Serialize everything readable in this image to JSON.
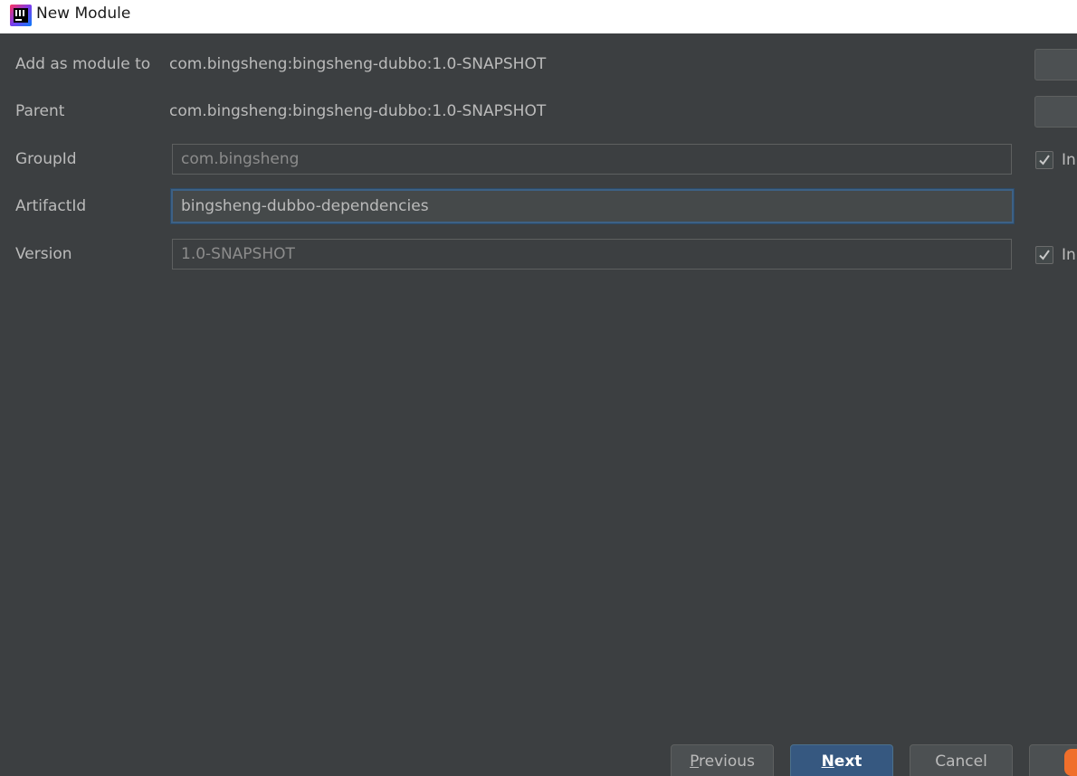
{
  "window": {
    "title": "New Module",
    "app_icon": "intellij-idea-icon"
  },
  "form": {
    "add_as_module_to": {
      "label": "Add as module to",
      "value": "com.bingsheng:bingsheng-dubbo:1.0-SNAPSHOT"
    },
    "parent": {
      "label": "Parent",
      "value": "com.bingsheng:bingsheng-dubbo:1.0-SNAPSHOT"
    },
    "group_id": {
      "label": "GroupId",
      "value": "com.bingsheng",
      "inherit_checked": true,
      "inherit_label": "In"
    },
    "artifact_id": {
      "label": "ArtifactId",
      "value": "bingsheng-dubbo-dependencies"
    },
    "version": {
      "label": "Version",
      "value": "1.0-SNAPSHOT",
      "inherit_checked": true,
      "inherit_label": "In"
    }
  },
  "footer": {
    "previous": {
      "mnemonic": "P",
      "rest": "revious"
    },
    "next": {
      "mnemonic": "N",
      "rest": "ext"
    },
    "cancel": "Cancel"
  },
  "colors": {
    "background": "#3c3f41",
    "text": "#bbbbbb",
    "accent": "#365880",
    "focus_border": "#3d6185"
  }
}
